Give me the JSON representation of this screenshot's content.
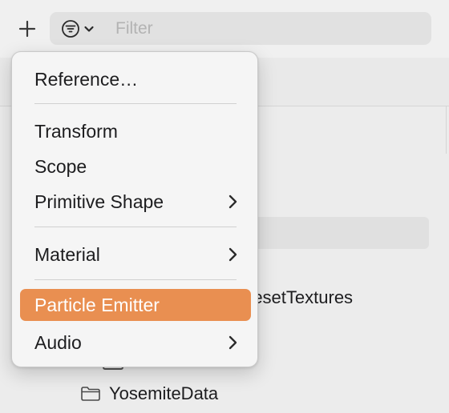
{
  "toolbar": {
    "add_icon": "plus-icon",
    "filter_menu_icon": "filter-circle-icon",
    "filter_chevron_icon": "chevron-down-icon",
    "filter_placeholder": "Filter"
  },
  "background_list": {
    "partial_item": "resetTextures",
    "folder_item": "YosemiteData",
    "folder_icon": "folder-icon"
  },
  "menu": {
    "items": [
      {
        "label": "Reference…",
        "submenu": false
      },
      {
        "label": "Transform",
        "submenu": false
      },
      {
        "label": "Scope",
        "submenu": false
      },
      {
        "label": "Primitive Shape",
        "submenu": true
      },
      {
        "label": "Material",
        "submenu": true
      },
      {
        "label": "Particle Emitter",
        "submenu": false,
        "highlighted": true
      },
      {
        "label": "Audio",
        "submenu": true
      }
    ],
    "highlight_color": "#e98f51"
  }
}
